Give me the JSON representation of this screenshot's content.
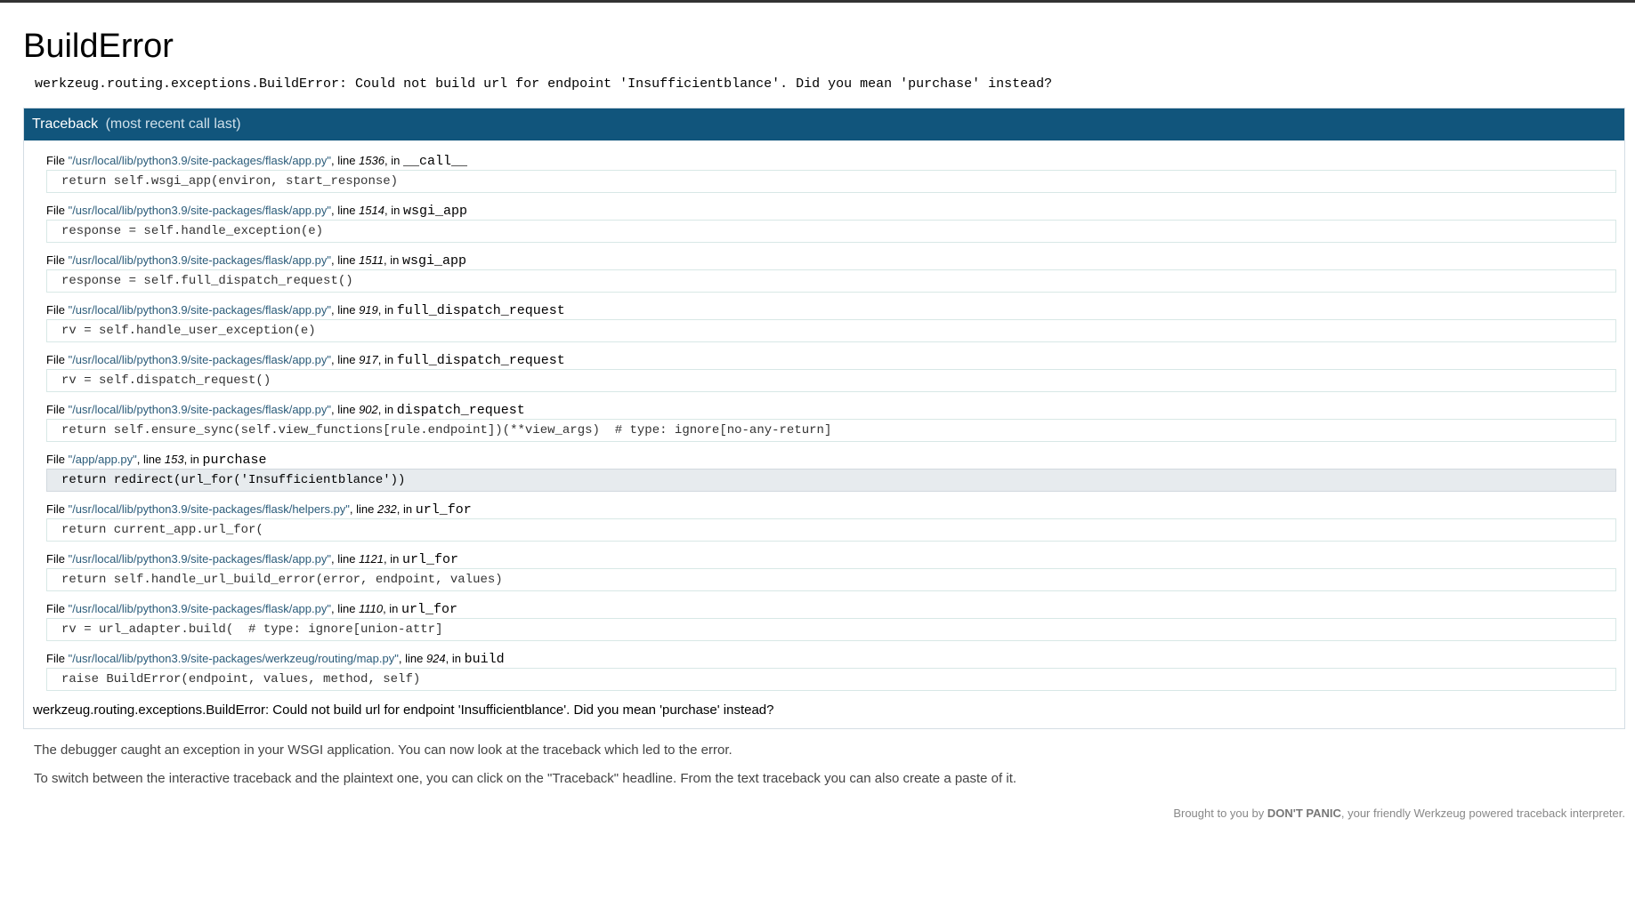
{
  "page": {
    "title": "BuildError",
    "error_message": "werkzeug.routing.exceptions.BuildError: Could not build url for endpoint 'Insufficientblance'. Did you mean 'purchase' instead?"
  },
  "traceback": {
    "header_label": "Traceback",
    "header_sub": "(most recent call last)",
    "file_word": "File",
    "line_word": ", line",
    "in_word": ", in",
    "frames": [
      {
        "file": "\"/usr/local/lib/python3.9/site-packages/flask/app.py\"",
        "line": "1536",
        "func": "__call__",
        "code": "return self.wsgi_app(environ, start_response)",
        "current": false
      },
      {
        "file": "\"/usr/local/lib/python3.9/site-packages/flask/app.py\"",
        "line": "1514",
        "func": "wsgi_app",
        "code": "response = self.handle_exception(e)",
        "current": false
      },
      {
        "file": "\"/usr/local/lib/python3.9/site-packages/flask/app.py\"",
        "line": "1511",
        "func": "wsgi_app",
        "code": "response = self.full_dispatch_request()",
        "current": false
      },
      {
        "file": "\"/usr/local/lib/python3.9/site-packages/flask/app.py\"",
        "line": "919",
        "func": "full_dispatch_request",
        "code": "rv = self.handle_user_exception(e)",
        "current": false
      },
      {
        "file": "\"/usr/local/lib/python3.9/site-packages/flask/app.py\"",
        "line": "917",
        "func": "full_dispatch_request",
        "code": "rv = self.dispatch_request()",
        "current": false
      },
      {
        "file": "\"/usr/local/lib/python3.9/site-packages/flask/app.py\"",
        "line": "902",
        "func": "dispatch_request",
        "code": "return self.ensure_sync(self.view_functions[rule.endpoint])(**view_args)  # type: ignore[no-any-return]",
        "current": false
      },
      {
        "file": "\"/app/app.py\"",
        "line": "153",
        "func": "purchase",
        "code": "return redirect(url_for('Insufficientblance'))",
        "current": true
      },
      {
        "file": "\"/usr/local/lib/python3.9/site-packages/flask/helpers.py\"",
        "line": "232",
        "func": "url_for",
        "code": "return current_app.url_for(",
        "current": false
      },
      {
        "file": "\"/usr/local/lib/python3.9/site-packages/flask/app.py\"",
        "line": "1121",
        "func": "url_for",
        "code": "return self.handle_url_build_error(error, endpoint, values)",
        "current": false
      },
      {
        "file": "\"/usr/local/lib/python3.9/site-packages/flask/app.py\"",
        "line": "1110",
        "func": "url_for",
        "code": "rv = url_adapter.build(  # type: ignore[union-attr]",
        "current": false
      },
      {
        "file": "\"/usr/local/lib/python3.9/site-packages/werkzeug/routing/map.py\"",
        "line": "924",
        "func": "build",
        "code": "raise BuildError(endpoint, values, method, self)",
        "current": false
      }
    ],
    "plain_error": "werkzeug.routing.exceptions.BuildError: Could not build url for endpoint 'Insufficientblance'. Did you mean 'purchase' instead?"
  },
  "explanation": {
    "p1": "The debugger caught an exception in your WSGI application. You can now look at the traceback which led to the error.",
    "p2": "To switch between the interactive traceback and the plaintext one, you can click on the \"Traceback\" headline. From the text traceback you can also create a paste of it."
  },
  "footer": {
    "prefix": "Brought to you by ",
    "brand": "DON'T PANIC",
    "suffix": ", your friendly Werkzeug powered traceback interpreter."
  },
  "colors": {
    "header_bg": "#11557c",
    "current_frame_bg": "#e7ebee"
  }
}
